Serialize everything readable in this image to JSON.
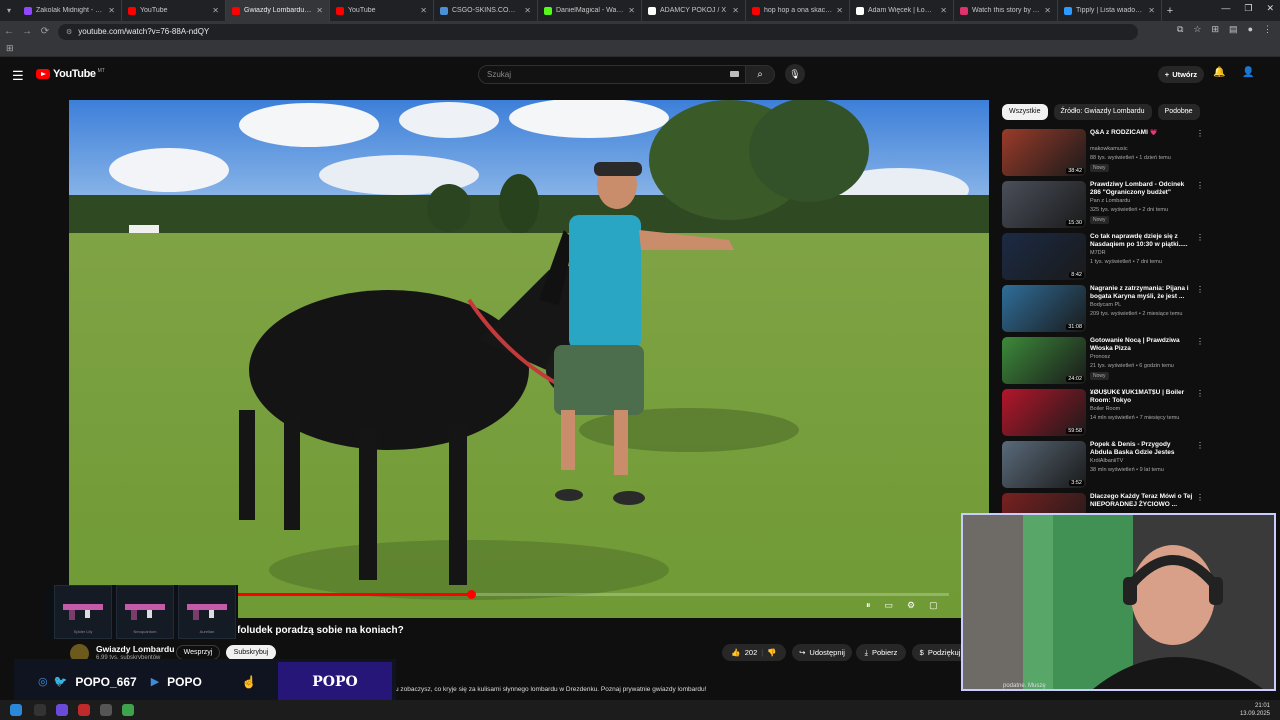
{
  "browser": {
    "tabs": [
      {
        "label": "Zakolak Midnight - Łysy Y",
        "icon": "twitch-icon",
        "color": "#9146ff",
        "active": false
      },
      {
        "label": "YouTube",
        "icon": "youtube-icon",
        "color": "#ff0000",
        "active": false
      },
      {
        "label": "Gwiazdy Lombardu Czy Ry",
        "icon": "youtube-icon",
        "color": "#ff0000",
        "active": true
      },
      {
        "label": "YouTube",
        "icon": "youtube-icon",
        "color": "#ff0000",
        "active": false
      },
      {
        "label": "CSGO-SKINS.COM - Najle",
        "icon": "globe-icon",
        "color": "#4a90d9",
        "active": false
      },
      {
        "label": "DanielMagical - Watch cli",
        "icon": "kick-icon",
        "color": "#53fc18",
        "active": false
      },
      {
        "label": "ADAMCY POKOJ / X",
        "icon": "x-icon",
        "color": "#ffffff",
        "active": false
      },
      {
        "label": "hop hop a ona skaczcp",
        "icon": "youtube-icon",
        "color": "#ff0000",
        "active": false
      },
      {
        "label": "Adam Więcek | Łowca",
        "icon": "x-icon",
        "color": "#ffffff",
        "active": false
      },
      {
        "label": "Watch this story by Adrian",
        "icon": "instagram-icon",
        "color": "#e1306c",
        "active": false
      },
      {
        "label": "Tipply | Lista wiadomości",
        "icon": "tipply-icon",
        "color": "#2b9bff",
        "active": false
      }
    ],
    "url": "youtube.com/watch?v=76-88A-ndQY"
  },
  "youtube": {
    "logo_text": "YouTube",
    "country": "MT",
    "search_placeholder": "Szukaj",
    "create_label": "Utwórz"
  },
  "video": {
    "title": "foludek poradzą sobie na koniach?",
    "progress_fraction": 0.33,
    "channel": "Gwiazdy Lombardu",
    "subscribers": "6,99 tys. subskrybentów",
    "join_label": "Wesprzyj",
    "subscribe_label": "Subskrybuj",
    "likes": "202",
    "share_label": "Udostępnij",
    "download_label": "Pobierz",
    "thanks_label": "Podziękuj",
    "description": "u zobaczysz, co kryje się za kulisami słynnego lombardu w Drezdenku. Poznaj prywatnie gwiazdy lombardu!"
  },
  "sidebar": {
    "chips": [
      "Wszystkie",
      "Źródło: Gwiazdy Lombardu",
      "Podobne"
    ],
    "recommendations": [
      {
        "title": "Q&A z RODZICAMI 💗",
        "channel": "makowkamusic",
        "meta": "88 tys. wyświetleń • 1 dzień temu",
        "badge": "Nowy",
        "duration": "38:42",
        "color": "#9a3b2a"
      },
      {
        "title": "Prawdziwy Lombard - Odcinek 286 \"Ograniczony budżet\"",
        "channel": "Pan z Lombardu",
        "meta": "325 tys. wyświetleń • 2 dni temu",
        "badge": "Nowy",
        "duration": "15:30",
        "color": "#4a4f5a"
      },
      {
        "title": "Co tak naprawdę dzieje się z Nasdaqiem po 10:30 w piątki.....",
        "channel": "M7DR",
        "meta": "1 tys. wyświetleń • 7 dni temu",
        "badge": "",
        "duration": "8:42",
        "color": "#1b2a44"
      },
      {
        "title": "Nagranie z zatrzymania: Pijana i bogata Karyna myśli, że jest ...",
        "channel": "Bodycam PL",
        "meta": "209 tys. wyświetleń • 2 miesiące temu",
        "badge": "",
        "duration": "31:08",
        "color": "#2f6e9a"
      },
      {
        "title": "Gotowanie Nocą | Prawdziwa Włoska Pizza",
        "channel": "Pronosz",
        "meta": "21 tys. wyświetleń • 6 godzin temu",
        "badge": "Nowy",
        "duration": "24:02",
        "color": "#3c8a3a"
      },
      {
        "title": "¥ØU$UK€ ¥UK1MAT$U | Boiler Room: Tokyo",
        "channel": "Boiler Room",
        "meta": "14 mln wyświetleń • 7 miesięcy temu",
        "badge": "",
        "duration": "59:58",
        "color": "#b4162a"
      },
      {
        "title": "Popek & Denis - Przygody Abdula Baska Gdzie Jestes",
        "channel": "KrólAlbaniiTV",
        "meta": "38 mln wyświetleń • 9 lat temu",
        "badge": "",
        "duration": "3:52",
        "color": "#5a6a7a"
      },
      {
        "title": "Dlaczego Każdy Teraz Mówi o Tej NIEPORADNEJ ŻYCIOWO ...",
        "channel": "",
        "meta": "",
        "badge": "",
        "duration": "",
        "color": "#7a2020"
      }
    ]
  },
  "overlay": {
    "socials": "POPO_667",
    "youtube_handle": "POPO",
    "brand": "POPO",
    "guns": [
      "Spider Lily",
      "Neoquantum",
      "Aurelian"
    ],
    "webcam_caption": "podatne. Muszę"
  },
  "taskbar": {
    "time": "21:01",
    "date": "13.09.2025"
  }
}
